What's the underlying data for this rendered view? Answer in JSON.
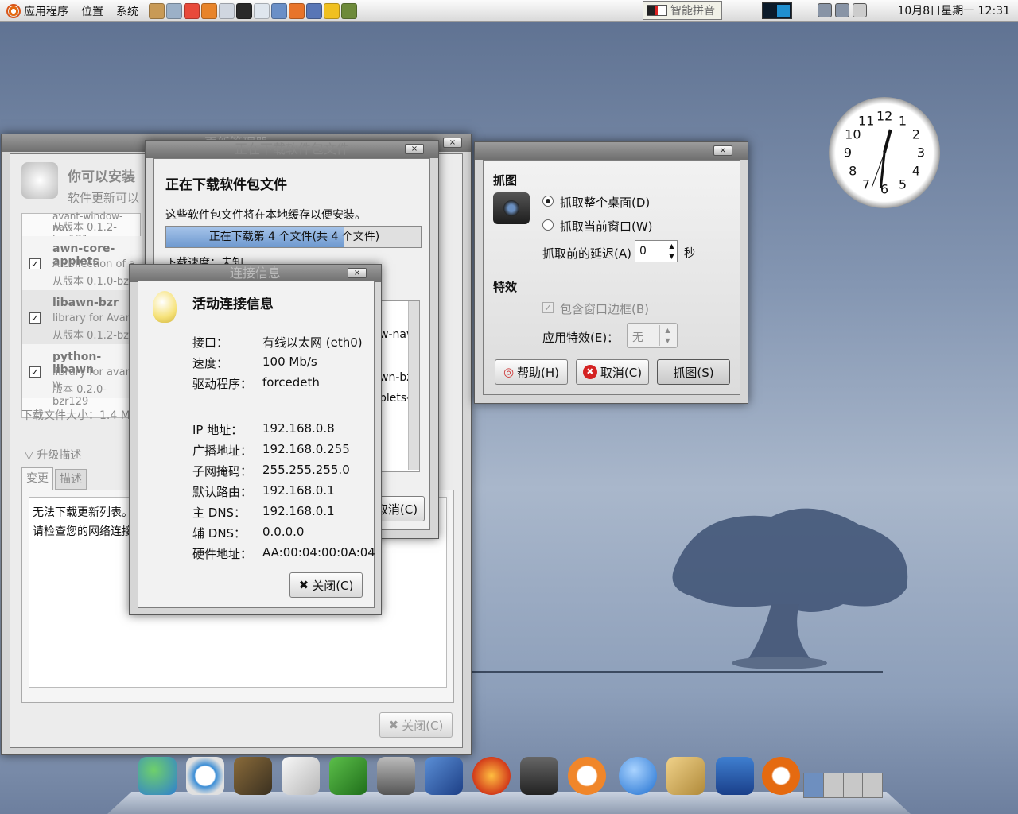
{
  "top_panel": {
    "menu": [
      "应用程序",
      "位置",
      "系统"
    ],
    "ime_label": "智能拼音",
    "datetime": "10月8日星期一 12:31"
  },
  "update_manager": {
    "title": "更新管理器",
    "heading": "你可以安装",
    "subheading": "软件更新可以",
    "items": [
      {
        "name": "awn-core-applets",
        "desc": "A collection of a",
        "version": "从版本 0.1.0-bzr"
      },
      {
        "name": "libawn-bzr",
        "desc": "library for Avant",
        "version": "从版本 0.1.2-bzr1"
      },
      {
        "name": "python-libawn",
        "desc": "library for avant-w",
        "version": "版本 0.2.0-bzr129"
      }
    ],
    "first_item_version": "从版本 0.1.2-bzr121",
    "first_item_partial": "avant-window-nav",
    "download_size": "下载文件大小：1.4 M",
    "expander_label": "升级描述",
    "tabs": [
      "变更",
      "描述"
    ],
    "changes_text_line1": "无法下载更新列表。",
    "changes_text_line2": "请检查您的网络连接",
    "close_button": "关闭(C)"
  },
  "download_window": {
    "title": "正在下载软件包文件",
    "heading": "正在下载软件包文件",
    "description": "这些软件包文件将在本地缓存以便安装。",
    "progress_text": "正在下载第 4 个文件(共 4 个文件)",
    "progress_fraction": 0.7,
    "speed_label": "下载速度：未知",
    "partial_list": [
      "w-nav",
      "wn-bzr",
      "plets-l"
    ],
    "cancel_button": "取消(C)"
  },
  "connection_info": {
    "title": "连接信息",
    "heading": "活动连接信息",
    "rows_top": [
      {
        "label": "接口：",
        "value": "有线以太网 (eth0)"
      },
      {
        "label": "速度：",
        "value": "100 Mb/s"
      },
      {
        "label": "驱动程序：",
        "value": "forcedeth"
      }
    ],
    "rows_bottom": [
      {
        "label": "IP 地址：",
        "value": "192.168.0.8"
      },
      {
        "label": "广播地址：",
        "value": "192.168.0.255"
      },
      {
        "label": "子网掩码：",
        "value": "255.255.255.0"
      },
      {
        "label": "默认路由：",
        "value": "192.168.0.1"
      },
      {
        "label": "主 DNS：",
        "value": "192.168.0.1"
      },
      {
        "label": "辅 DNS：",
        "value": "0.0.0.0"
      },
      {
        "label": "硬件地址：",
        "value": "AA:00:04:00:0A:04"
      }
    ],
    "close_button": "关闭(C)"
  },
  "screenshot_tool": {
    "grab_section": "抓图",
    "option_desktop": "抓取整个桌面(D)",
    "option_window": "抓取当前窗口(W)",
    "delay_label": "抓取前的延迟(A)",
    "delay_value": "0",
    "delay_unit": "秒",
    "effects_section": "特效",
    "include_border": "包含窗口边框(B)",
    "effect_label": "应用特效(E)：",
    "effect_value": "无",
    "help_button": "帮助(H)",
    "cancel_button": "取消(C)",
    "grab_button": "抓图(S)"
  },
  "desktop_clock": {
    "numbers": [
      "12",
      "1",
      "2",
      "3",
      "4",
      "5",
      "6",
      "7",
      "8",
      "9",
      "10",
      "11"
    ]
  },
  "colors": {
    "progress_fill": "#7fa6d6",
    "cancel_red": "#d42222"
  }
}
